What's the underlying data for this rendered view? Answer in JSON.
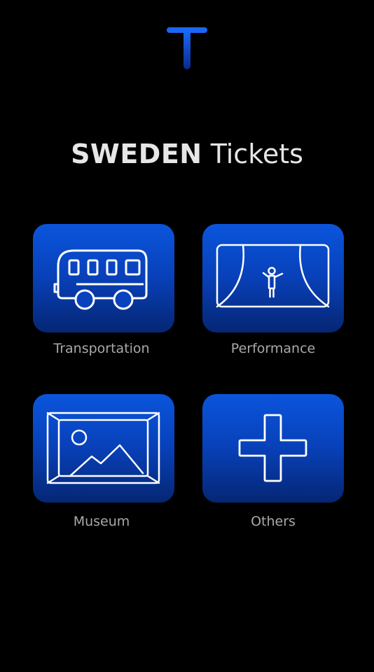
{
  "app": {
    "title_bold": "SWEDEN",
    "title_rest": "Tickets",
    "logo_icon": "t-logo-icon",
    "accent_color": "#0a55dc"
  },
  "categories": [
    {
      "id": "transportation",
      "label": "Transportation",
      "icon": "bus-icon"
    },
    {
      "id": "performance",
      "label": "Performance",
      "icon": "theater-stage-icon"
    },
    {
      "id": "museum",
      "label": "Museum",
      "icon": "picture-frame-icon"
    },
    {
      "id": "others",
      "label": "Others",
      "icon": "plus-icon"
    }
  ]
}
